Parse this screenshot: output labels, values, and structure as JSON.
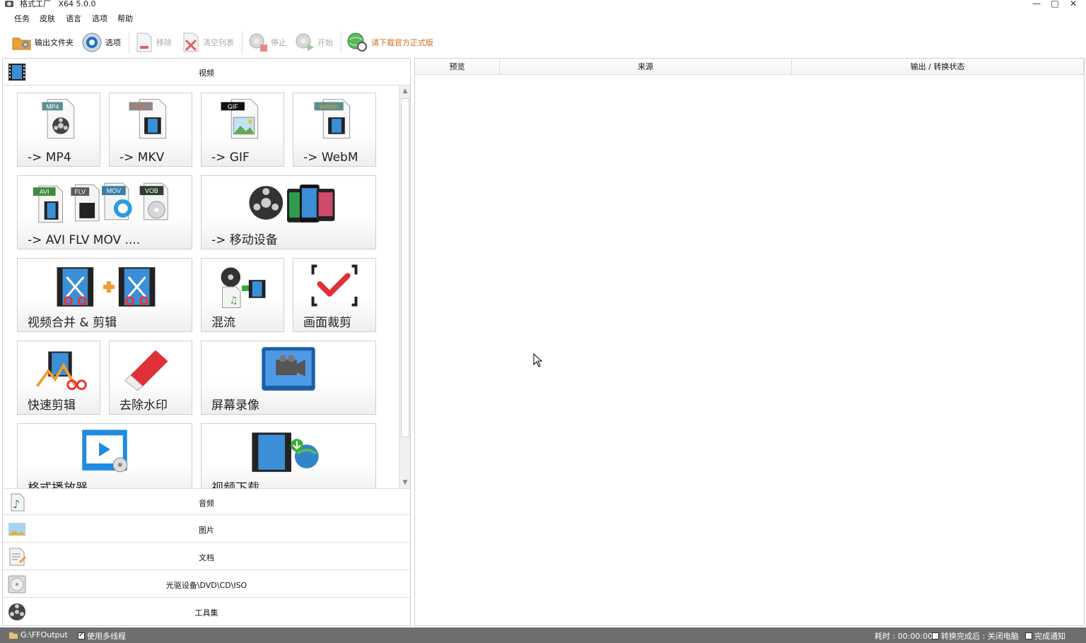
{
  "window": {
    "title": "格式工厂   X64 5.0.0",
    "minimize": "—",
    "maximize": "□",
    "close": "✕"
  },
  "menu": [
    "任务",
    "皮肤",
    "语言",
    "选项",
    "帮助"
  ],
  "toolbar": {
    "output_folder": "输出文件夹",
    "options": "选项",
    "remove": "移除",
    "clear_list": "清空列表",
    "stop": "停止",
    "start": "开始",
    "download_official": "请下载官方正式版"
  },
  "categories": {
    "video": "视频",
    "audio": "音频",
    "image": "图片",
    "document": "文档",
    "optical": "光驱设备\\DVD\\CD\\ISO",
    "tools": "工具集"
  },
  "tiles": [
    {
      "label": "-> MP4",
      "badge": "MP4"
    },
    {
      "label": "-> MKV",
      "badge": "MKV"
    },
    {
      "label": "-> GIF",
      "badge": "GIF"
    },
    {
      "label": "-> WebM",
      "badge": "webm"
    },
    {
      "label": "-> AVI FLV MOV ....",
      "badges": [
        "AVI",
        "FLV",
        "MOV",
        "VOB"
      ]
    },
    {
      "label": "-> 移动设备"
    },
    {
      "label": "视频合并 & 剪辑"
    },
    {
      "label": "混流"
    },
    {
      "label": "画面裁剪"
    },
    {
      "label": "快速剪辑"
    },
    {
      "label": "去除水印"
    },
    {
      "label": "屏幕录像"
    },
    {
      "label": "格式播放器"
    },
    {
      "label": "视频下载"
    }
  ],
  "task_columns": [
    "预览",
    "来源",
    "输出 / 转换状态"
  ],
  "status": {
    "output_path": "G:\\FFOutput",
    "multithread": "使用多线程",
    "elapsed": "耗时 : 00:00:00",
    "after_convert": "转换完成后 : 关闭电脑",
    "notify": "完成通知"
  },
  "colors": {
    "statusbar": "#6e6e6e",
    "link": "#d2691e",
    "disabled": "#aaaaaa"
  }
}
